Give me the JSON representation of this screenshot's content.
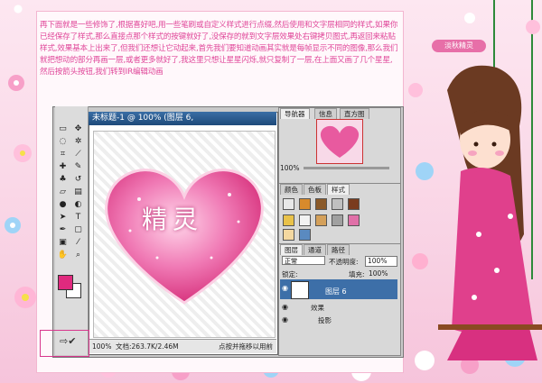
{
  "intro_text": "再下面就是一些修饰了,根据喜好吧,用一些笔刷或自定义样式进行点缀,然后使用和文字层相同的样式,如果你已经保存了样式,那么直接点那个样式的按键就好了,没保存的就到文字层效果处右键拷贝图式,再返回来粘贴样式,效果基本上出来了,但我们还想让它动起来,首先我们要知道动画其实就是每帧显示不同的图像,那么我们就把想动的部分再画一层,或者更多就好了,我这里只想让星星闪烁,就只复制了一层,在上面又画了几个星星,然后按箭头按钮,我们转到IR编辑动画",
  "document": {
    "title": "未标题-1 @ 100% (图层 6,",
    "heart_text": "精灵",
    "status_zoom": "100%",
    "status_doc": "文档:263.7K/2.46M",
    "status_hint": "点按并拖移以用前"
  },
  "navigator": {
    "tabs": [
      "导航器",
      "信息",
      "直方图"
    ],
    "zoom": "100%"
  },
  "styles_panel": {
    "tabs": [
      "颜色",
      "色板",
      "样式"
    ]
  },
  "layers_panel": {
    "tabs": [
      "图层",
      "通道",
      "路径"
    ],
    "blend_mode": "正常",
    "opacity_label": "不透明度:",
    "opacity_value": "100%",
    "lock_label": "锁定:",
    "fill_label": "填充:",
    "fill_value": "100%",
    "active_layer": "图层 6",
    "effects_label": "效果",
    "effect_item": "投影"
  },
  "badge_text": "淡秋精灵",
  "colors": {
    "accent": "#e0489a",
    "foreground": "#e02a7e",
    "layer_selected": "#3d6fa8"
  }
}
